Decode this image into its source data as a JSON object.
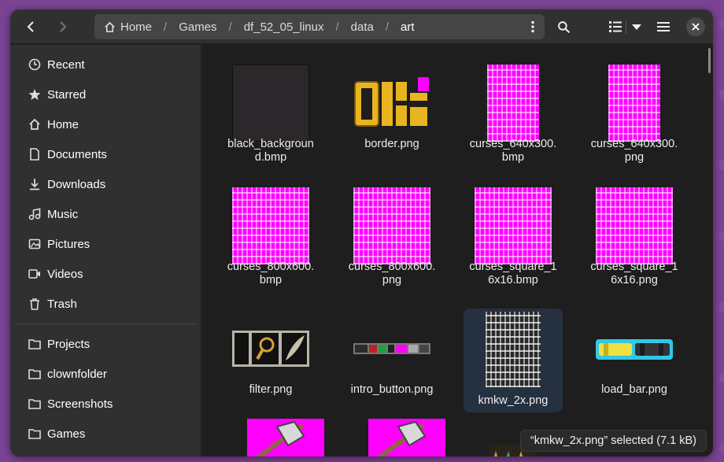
{
  "colors": {
    "desktop": "#7a4394",
    "window": "#242424",
    "sidebar": "#303030",
    "content": "#1e1e1e",
    "selection": "#253140",
    "magenta": "#ff00ff"
  },
  "pathbar": {
    "home_label": "Home",
    "crumbs": [
      "Games",
      "df_52_05_linux",
      "data",
      "art"
    ]
  },
  "sidebar": {
    "places": [
      {
        "label": "Recent",
        "icon": "clock-icon"
      },
      {
        "label": "Starred",
        "icon": "star-icon"
      },
      {
        "label": "Home",
        "icon": "home-icon"
      },
      {
        "label": "Documents",
        "icon": "document-icon"
      },
      {
        "label": "Downloads",
        "icon": "download-icon"
      },
      {
        "label": "Music",
        "icon": "music-icon"
      },
      {
        "label": "Pictures",
        "icon": "picture-icon"
      },
      {
        "label": "Videos",
        "icon": "video-icon"
      },
      {
        "label": "Trash",
        "icon": "trash-icon"
      }
    ],
    "bookmarks": [
      {
        "label": "Projects",
        "icon": "folder-icon"
      },
      {
        "label": "clownfolder",
        "icon": "folder-icon"
      },
      {
        "label": "Screenshots",
        "icon": "folder-icon"
      },
      {
        "label": "Games",
        "icon": "folder-icon"
      }
    ]
  },
  "files": [
    {
      "name": "black_background.bmp",
      "thumb": "black"
    },
    {
      "name": "border.png",
      "thumb": "border"
    },
    {
      "name": "curses_640x300.bmp",
      "thumb": "font"
    },
    {
      "name": "curses_640x300.png",
      "thumb": "font"
    },
    {
      "name": "curses_800x600.bmp",
      "thumb": "font"
    },
    {
      "name": "curses_800x600.png",
      "thumb": "font"
    },
    {
      "name": "curses_square_16x16.bmp",
      "thumb": "font"
    },
    {
      "name": "curses_square_16x16.png",
      "thumb": "font"
    },
    {
      "name": "filter.png",
      "thumb": "filter"
    },
    {
      "name": "intro_button.png",
      "thumb": "intro"
    },
    {
      "name": "kmkw_2x.png",
      "thumb": "font-mono",
      "selected": true
    },
    {
      "name": "load_bar.png",
      "thumb": "loadbar"
    }
  ],
  "status": {
    "text": "“kmkw_2x.png” selected  (7.1 kB)"
  }
}
